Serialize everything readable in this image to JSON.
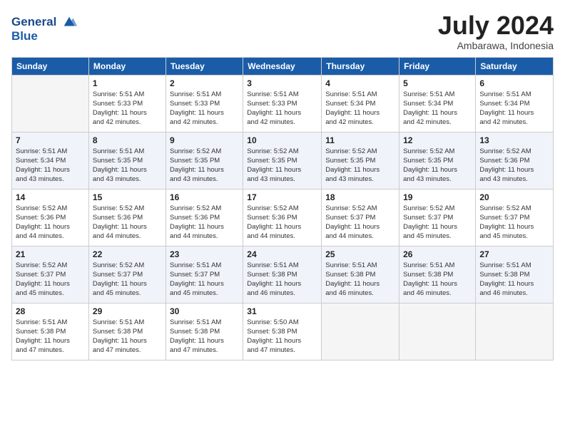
{
  "header": {
    "logo_line1": "General",
    "logo_line2": "Blue",
    "month_title": "July 2024",
    "subtitle": "Ambarawa, Indonesia"
  },
  "days_of_week": [
    "Sunday",
    "Monday",
    "Tuesday",
    "Wednesday",
    "Thursday",
    "Friday",
    "Saturday"
  ],
  "weeks": [
    [
      {
        "num": "",
        "info": ""
      },
      {
        "num": "1",
        "info": "Sunrise: 5:51 AM\nSunset: 5:33 PM\nDaylight: 11 hours\nand 42 minutes."
      },
      {
        "num": "2",
        "info": "Sunrise: 5:51 AM\nSunset: 5:33 PM\nDaylight: 11 hours\nand 42 minutes."
      },
      {
        "num": "3",
        "info": "Sunrise: 5:51 AM\nSunset: 5:33 PM\nDaylight: 11 hours\nand 42 minutes."
      },
      {
        "num": "4",
        "info": "Sunrise: 5:51 AM\nSunset: 5:34 PM\nDaylight: 11 hours\nand 42 minutes."
      },
      {
        "num": "5",
        "info": "Sunrise: 5:51 AM\nSunset: 5:34 PM\nDaylight: 11 hours\nand 42 minutes."
      },
      {
        "num": "6",
        "info": "Sunrise: 5:51 AM\nSunset: 5:34 PM\nDaylight: 11 hours\nand 42 minutes."
      }
    ],
    [
      {
        "num": "7",
        "info": "Sunrise: 5:51 AM\nSunset: 5:34 PM\nDaylight: 11 hours\nand 43 minutes."
      },
      {
        "num": "8",
        "info": "Sunrise: 5:51 AM\nSunset: 5:35 PM\nDaylight: 11 hours\nand 43 minutes."
      },
      {
        "num": "9",
        "info": "Sunrise: 5:52 AM\nSunset: 5:35 PM\nDaylight: 11 hours\nand 43 minutes."
      },
      {
        "num": "10",
        "info": "Sunrise: 5:52 AM\nSunset: 5:35 PM\nDaylight: 11 hours\nand 43 minutes."
      },
      {
        "num": "11",
        "info": "Sunrise: 5:52 AM\nSunset: 5:35 PM\nDaylight: 11 hours\nand 43 minutes."
      },
      {
        "num": "12",
        "info": "Sunrise: 5:52 AM\nSunset: 5:35 PM\nDaylight: 11 hours\nand 43 minutes."
      },
      {
        "num": "13",
        "info": "Sunrise: 5:52 AM\nSunset: 5:36 PM\nDaylight: 11 hours\nand 43 minutes."
      }
    ],
    [
      {
        "num": "14",
        "info": "Sunrise: 5:52 AM\nSunset: 5:36 PM\nDaylight: 11 hours\nand 44 minutes."
      },
      {
        "num": "15",
        "info": "Sunrise: 5:52 AM\nSunset: 5:36 PM\nDaylight: 11 hours\nand 44 minutes."
      },
      {
        "num": "16",
        "info": "Sunrise: 5:52 AM\nSunset: 5:36 PM\nDaylight: 11 hours\nand 44 minutes."
      },
      {
        "num": "17",
        "info": "Sunrise: 5:52 AM\nSunset: 5:36 PM\nDaylight: 11 hours\nand 44 minutes."
      },
      {
        "num": "18",
        "info": "Sunrise: 5:52 AM\nSunset: 5:37 PM\nDaylight: 11 hours\nand 44 minutes."
      },
      {
        "num": "19",
        "info": "Sunrise: 5:52 AM\nSunset: 5:37 PM\nDaylight: 11 hours\nand 45 minutes."
      },
      {
        "num": "20",
        "info": "Sunrise: 5:52 AM\nSunset: 5:37 PM\nDaylight: 11 hours\nand 45 minutes."
      }
    ],
    [
      {
        "num": "21",
        "info": "Sunrise: 5:52 AM\nSunset: 5:37 PM\nDaylight: 11 hours\nand 45 minutes."
      },
      {
        "num": "22",
        "info": "Sunrise: 5:52 AM\nSunset: 5:37 PM\nDaylight: 11 hours\nand 45 minutes."
      },
      {
        "num": "23",
        "info": "Sunrise: 5:51 AM\nSunset: 5:37 PM\nDaylight: 11 hours\nand 45 minutes."
      },
      {
        "num": "24",
        "info": "Sunrise: 5:51 AM\nSunset: 5:38 PM\nDaylight: 11 hours\nand 46 minutes."
      },
      {
        "num": "25",
        "info": "Sunrise: 5:51 AM\nSunset: 5:38 PM\nDaylight: 11 hours\nand 46 minutes."
      },
      {
        "num": "26",
        "info": "Sunrise: 5:51 AM\nSunset: 5:38 PM\nDaylight: 11 hours\nand 46 minutes."
      },
      {
        "num": "27",
        "info": "Sunrise: 5:51 AM\nSunset: 5:38 PM\nDaylight: 11 hours\nand 46 minutes."
      }
    ],
    [
      {
        "num": "28",
        "info": "Sunrise: 5:51 AM\nSunset: 5:38 PM\nDaylight: 11 hours\nand 47 minutes."
      },
      {
        "num": "29",
        "info": "Sunrise: 5:51 AM\nSunset: 5:38 PM\nDaylight: 11 hours\nand 47 minutes."
      },
      {
        "num": "30",
        "info": "Sunrise: 5:51 AM\nSunset: 5:38 PM\nDaylight: 11 hours\nand 47 minutes."
      },
      {
        "num": "31",
        "info": "Sunrise: 5:50 AM\nSunset: 5:38 PM\nDaylight: 11 hours\nand 47 minutes."
      },
      {
        "num": "",
        "info": ""
      },
      {
        "num": "",
        "info": ""
      },
      {
        "num": "",
        "info": ""
      }
    ]
  ]
}
